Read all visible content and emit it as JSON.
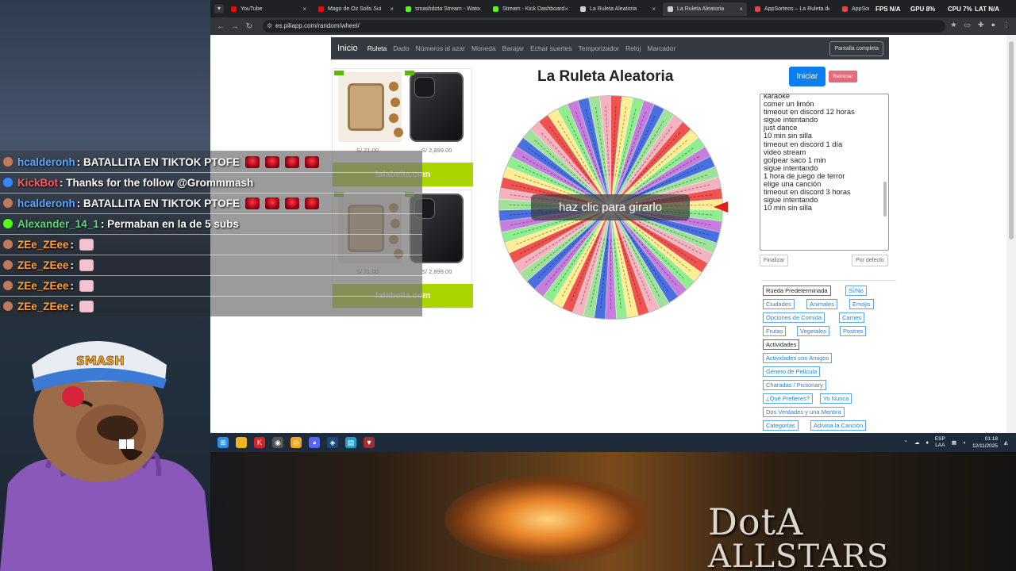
{
  "browser": {
    "tabs": [
      {
        "title": "YouTube",
        "color": "#ff0000"
      },
      {
        "title": "Mago de Oz Solis Sui",
        "color": "#ff0000"
      },
      {
        "title": "smashdota Stream - Watc",
        "color": "#53fc18"
      },
      {
        "title": "Stream - Kick Dashboard",
        "color": "#53fc18"
      },
      {
        "title": "La Ruleta Aleatoria",
        "color": "#cfcfcf"
      },
      {
        "title": "La Ruleta Aleatoria",
        "color": "#cfcfcf"
      },
      {
        "title": "AppSorteos – La Ruleta d",
        "color": "#e8463a"
      },
      {
        "title": "AppSorteos – La Ruleta",
        "color": "#e8463a"
      }
    ],
    "url": "es.piliapp.com/random/wheel/"
  },
  "hud": {
    "fps_label": "FPS",
    "fps_value": "N/A",
    "gpu_label": "GPU",
    "gpu_value": "8%",
    "cpu_label": "CPU",
    "cpu_value": "7%",
    "lat_label": "LAT",
    "lat_value": "N/A"
  },
  "site_nav": {
    "brand": "Inicio",
    "links": [
      "Ruleta",
      "Dado",
      "Números al azar",
      "Moneda",
      "Barajar",
      "Echar suertes",
      "Temporizador",
      "Reloj",
      "Marcador"
    ],
    "fullscreen": "Pantalla completa"
  },
  "ads": [
    {
      "price1": "S/ 21.00",
      "price2": "S/ 2,899.00",
      "brand": "falabella.com"
    },
    {
      "price1": "S/ 21.00",
      "price2": "S/ 2,899.00",
      "brand": "falabella.com"
    }
  ],
  "wheel": {
    "title": "La Ruleta Aleatoria",
    "start_label": "Iniciar",
    "reset_label": "Reiniciar",
    "spin_label": "haz clic para girarlo",
    "segment_colors": [
      "#ef5350",
      "#ffee93",
      "#90ee90",
      "#c77dde",
      "#4a6fe0",
      "#9fe39a",
      "#f6b2c0"
    ]
  },
  "entries_text": "karaoke\ncomer un limón\ntimeout en discord 12 horas\nsigue intentando\njust dance\n10 min sin silla\ntimeout en discord 1 día\nvideo stream\ngolpear saco 1 min\nsigue intentando\n1 hora de juego de terror\nelige una canción\ntimeout en discord 3 horas\nsigue intentando\n10 min sin silla",
  "entry_buttons": {
    "finalize": "Finalizar",
    "default": "Por defecto"
  },
  "presets": [
    "Rueda Predeterminada",
    "Sí/No",
    "Ciudades",
    "Animales",
    "Emojis",
    "Opciones de Comida",
    "Carnes",
    "Frutas",
    "Vegetales",
    "Postres",
    "Actividades",
    "Actividades con Amigos",
    "Género de Película",
    "Charadas / Pictionary",
    "¿Qué Prefieres?",
    "Yo Nunca",
    "Dos Verdades y una Mentira",
    "Categorías",
    "Adivina la Canción"
  ],
  "taskbar": {
    "lang1": "ESP",
    "lang2": "LAA",
    "time": "01:18",
    "date": "12/11/2025"
  },
  "chat": [
    {
      "user": "hcalderonh",
      "color": "#5aa9ff",
      "message": ": BATALLITA EN TIKTOK PTOFE",
      "emotes": "siren",
      "count": 4
    },
    {
      "user": "KickBot",
      "color": "#ff5b5b",
      "message": ": Thanks for the follow @Grommmash",
      "emotes": "",
      "count": 0
    },
    {
      "user": "hcalderonh",
      "color": "#5aa9ff",
      "message": ": BATALLITA EN TIKTOK PTOFE",
      "emotes": "siren",
      "count": 4
    },
    {
      "user": "Alexander_14_1",
      "color": "#5fd47a",
      "message": ": Permaban en la de 5 subs",
      "emotes": "",
      "count": 0
    },
    {
      "user": "ZEe_ZEee",
      "color": "#ff9f3a",
      "message": ":",
      "emotes": "pig",
      "count": 1
    },
    {
      "user": "ZEe_ZEee",
      "color": "#ff9f3a",
      "message": ":",
      "emotes": "pig",
      "count": 1
    },
    {
      "user": "ZEe_ZEee",
      "color": "#ff9f3a",
      "message": ":",
      "emotes": "pig",
      "count": 1
    },
    {
      "user": "ZEe_ZEee",
      "color": "#ff9f3a",
      "message": ":",
      "emotes": "pig",
      "count": 1
    }
  ],
  "overlay": {
    "mascot_cap_text": "SMASH",
    "game_logo_line1": "DotA",
    "game_logo_line2": "ALLSTARS"
  }
}
